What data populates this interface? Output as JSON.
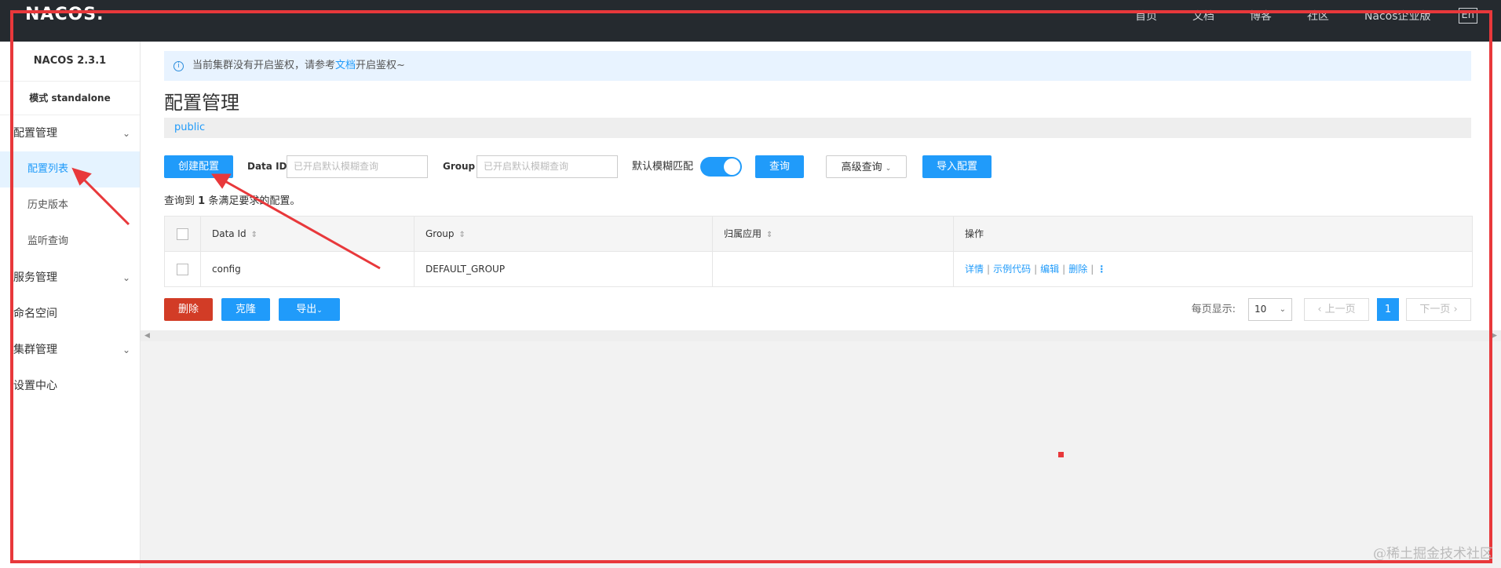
{
  "topbar": {
    "logo": "NACOS.",
    "nav": [
      "首页",
      "文档",
      "博客",
      "社区",
      "Nacos企业版"
    ],
    "lang": "En"
  },
  "sidebar": {
    "version": "NACOS 2.3.1",
    "mode": "模式 standalone",
    "groups": [
      {
        "label": "配置管理",
        "items": [
          "配置列表",
          "历史版本",
          "监听查询"
        ]
      },
      {
        "label": "服务管理"
      },
      {
        "label": "命名空间"
      },
      {
        "label": "集群管理"
      },
      {
        "label": "设置中心"
      }
    ]
  },
  "notice": {
    "prefix": "当前集群没有开启鉴权，请参考",
    "link": "文档",
    "suffix": "开启鉴权~"
  },
  "page_title": "配置管理",
  "namespace": "public",
  "toolbar": {
    "create_label": "创建配置",
    "data_id_label": "Data ID",
    "data_id_placeholder": "已开启默认模糊查询",
    "group_label": "Group",
    "group_placeholder": "已开启默认模糊查询",
    "fuzzy_label": "默认模糊匹配",
    "fuzzy_on": true,
    "query_label": "查询",
    "advanced_label": "高级查询",
    "import_label": "导入配置"
  },
  "result": {
    "prefix": "查询到",
    "count": "1",
    "suffix": "条满足要求的配置。"
  },
  "table": {
    "headers": [
      "Data Id",
      "Group",
      "归属应用",
      "操作"
    ],
    "rows": [
      {
        "data_id": "config",
        "group": "DEFAULT_GROUP",
        "app": "",
        "ops": [
          "详情",
          "示例代码",
          "编辑",
          "删除"
        ]
      }
    ]
  },
  "bottom": {
    "delete_label": "删除",
    "clone_label": "克隆",
    "export_label": "导出",
    "page_size_label": "每页显示:",
    "page_size": "10",
    "prev_label": "上一页",
    "current_page": "1",
    "next_label": "下一页"
  },
  "watermark": "@稀土掘金技术社区",
  "colors": {
    "accent": "#209bfa",
    "danger": "#d23c26",
    "topbar": "#252a2f",
    "annotation": "#e8383b"
  }
}
